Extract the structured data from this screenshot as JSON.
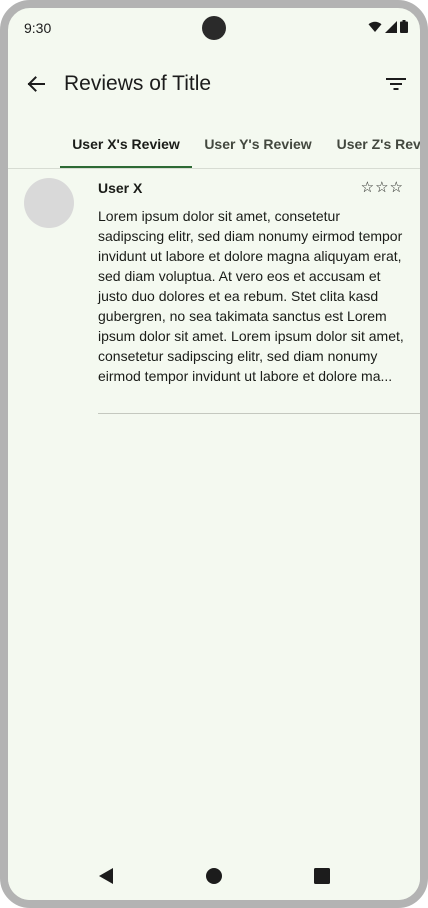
{
  "status_bar": {
    "time": "9:30",
    "icons": [
      "wifi-icon",
      "signal-icon",
      "battery-icon"
    ]
  },
  "app_bar": {
    "title": "Reviews of Title",
    "back_icon": "arrow-left-icon",
    "filter_icon": "filter-icon"
  },
  "tabs": [
    {
      "label": "User X's Review",
      "active": true
    },
    {
      "label": "User Y's Review",
      "active": false
    },
    {
      "label": "User Z's Review",
      "active": false
    }
  ],
  "review": {
    "user": "User X",
    "rating": "☆☆☆",
    "text": "Lorem ipsum dolor sit amet, consetetur sadipscing elitr, sed diam nonumy eirmod tempor invidunt ut labore et dolore magna aliquyam erat, sed diam voluptua. At vero eos et accusam et justo duo dolores et ea rebum. Stet clita kasd gubergren, no sea takimata sanctus est Lorem ipsum dolor sit amet. Lorem ipsum dolor sit amet, consetetur sadipscing elitr, sed diam nonumy eirmod tempor invidunt ut labore et dolore ma..."
  },
  "nav_bar": {
    "icons": [
      "back-triangle-icon",
      "home-circle-icon",
      "recents-square-icon"
    ]
  },
  "colors": {
    "background": "#f4f9f0",
    "accent": "#2d6a34",
    "avatar": "#d9d9d9"
  }
}
